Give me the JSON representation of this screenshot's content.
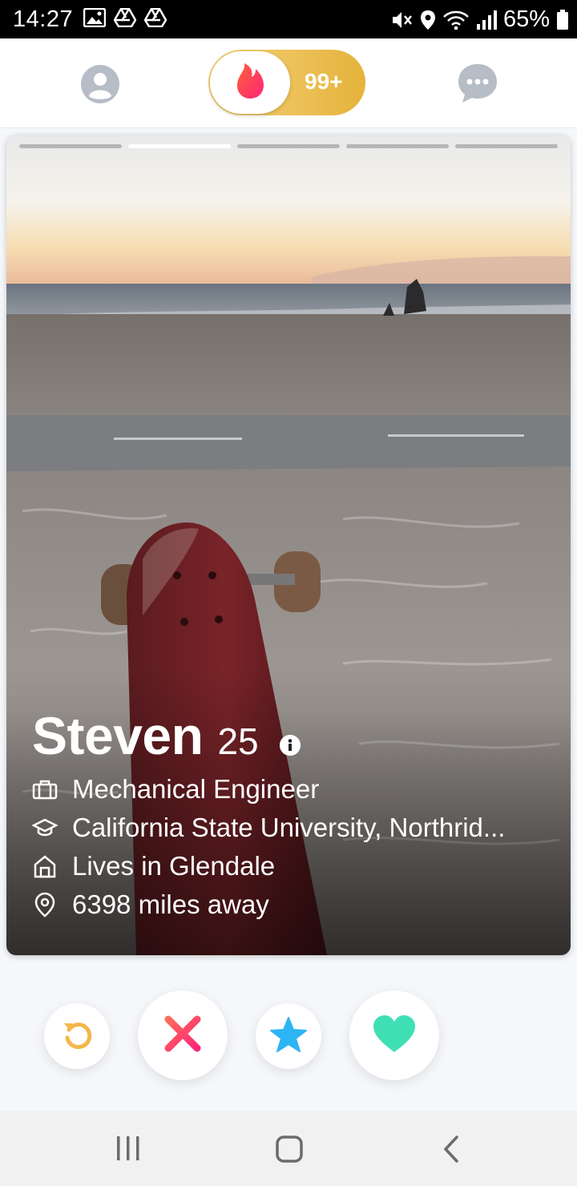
{
  "status_bar": {
    "time": "14:27",
    "battery": "65%"
  },
  "top_nav": {
    "likes_count": "99+",
    "accent": "#fd5068",
    "gold": "#e5b33c"
  },
  "card": {
    "photo_count": 5,
    "active_photo_index": 1,
    "name": "Steven",
    "age": "25",
    "job": "Mechanical Engineer",
    "school": "California State University, Northrid...",
    "lives": "Lives in Glendale",
    "distance": "6398 miles away"
  },
  "actions": {
    "rewind_color": "#f5b748",
    "nope_color": "#fd4d6d",
    "super_like_color": "#2db4f4",
    "like_color": "#3fe0b5"
  },
  "icons": [
    "gallery-icon",
    "drive-icon",
    "drive-icon",
    "mute-icon",
    "location-icon",
    "wifi-icon",
    "signal-icon",
    "battery-icon",
    "profile-icon",
    "flame-icon",
    "chat-icon",
    "info-icon",
    "briefcase-icon",
    "graduation-cap-icon",
    "home-icon",
    "map-pin-icon",
    "rewind-icon",
    "nope-icon",
    "star-icon",
    "heart-icon",
    "recents-icon",
    "home-button-icon",
    "back-icon"
  ]
}
